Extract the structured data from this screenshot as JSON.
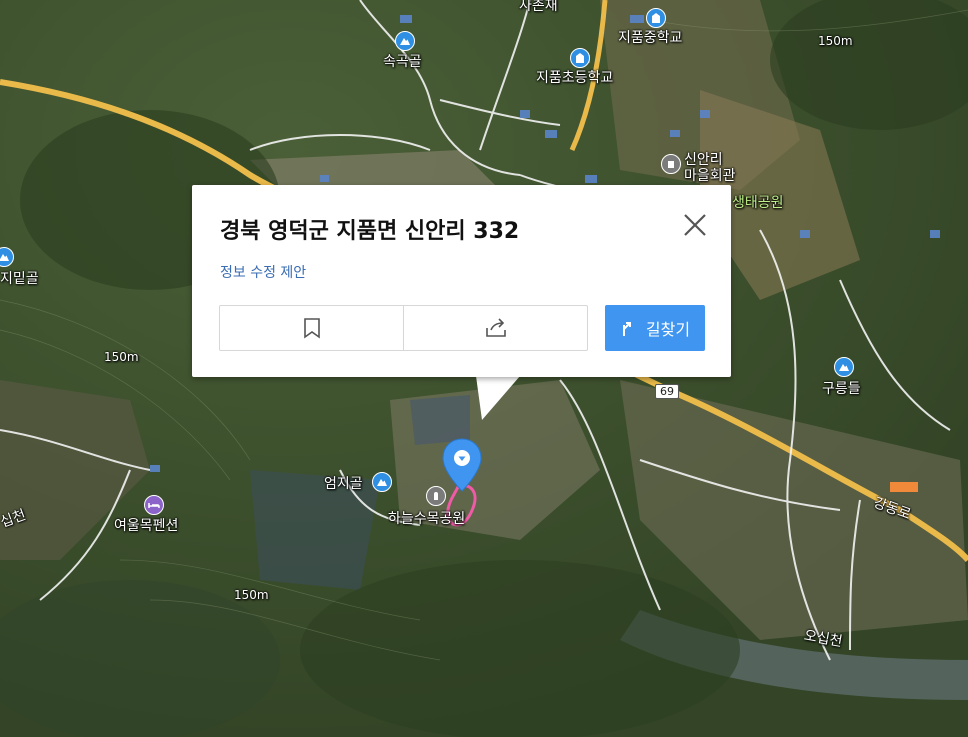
{
  "map": {
    "places": [
      {
        "name": "속곡골",
        "type": "mountain"
      },
      {
        "name": "지품중학교",
        "type": "school"
      },
      {
        "name": "지품초등학교",
        "type": "school"
      },
      {
        "name": "신안리",
        "type": "building"
      },
      {
        "name": "마을회관",
        "type": "text"
      },
      {
        "name": "생태공원",
        "type": "park"
      },
      {
        "name": "지밑골",
        "type": "mountain"
      },
      {
        "name": "구릉들",
        "type": "mountain"
      },
      {
        "name": "엄지골",
        "type": "mountain"
      },
      {
        "name": "하늘수목공원",
        "type": "cemetery"
      },
      {
        "name": "여울목펜션",
        "type": "lodging"
      },
      {
        "name": "강동로",
        "type": "road"
      },
      {
        "name": "오십천",
        "type": "river"
      },
      {
        "name": "십천",
        "type": "river"
      },
      {
        "name": "사촌재",
        "type": "text"
      }
    ],
    "elevations": [
      "150m",
      "150m",
      "150m"
    ],
    "route_number": "69",
    "colors": {
      "road_yellow": "#e9b94a",
      "pin_blue": "#2f8fe3",
      "pin_purple": "#8b63c9",
      "accent_pink": "#f05aa6"
    }
  },
  "popup": {
    "title": "경북 영덕군 지품면 신안리 332",
    "suggest_edit": "정보 수정 제안",
    "route_label": "길찾기",
    "icons": {
      "close": "close-icon",
      "bookmark": "bookmark-icon",
      "share": "share-icon",
      "route": "route-icon"
    },
    "accent": "#3f95f0"
  }
}
